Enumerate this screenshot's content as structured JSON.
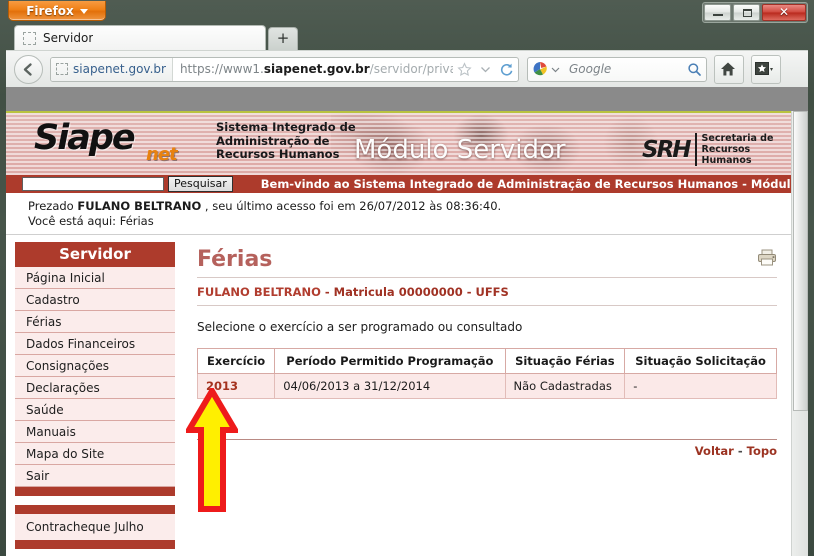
{
  "browser": {
    "app_button": "Firefox",
    "window_controls": {
      "minimize": "minimize-icon",
      "maximize": "maximize-icon",
      "close": "✕"
    },
    "tab": {
      "title": "Servidor",
      "favicon": "page-icon"
    },
    "new_tab_label": "+",
    "back_label": "back-arrow-icon",
    "url": {
      "site_chip": "siapenet.gov.br",
      "scheme": "https://www1.",
      "domain": "siapenet.gov.br",
      "path": "/servidor/private/pages/inform"
    },
    "star_icon": "star-icon",
    "dropdown_icon": "chevron-down-icon",
    "reload_icon": "reload-icon",
    "search": {
      "engine": "Google",
      "placeholder": "Google"
    },
    "home_icon": "home-icon",
    "bookmarks_icon": "bookmarks-icon"
  },
  "banner": {
    "logo_main": "Siape",
    "logo_suffix": "net",
    "tagline_line1": "Sistema Integrado de",
    "tagline_line2": "Administração de",
    "tagline_line3": "Recursos Humanos",
    "module": "Módulo Servidor",
    "srh_mark": "SRH",
    "srh_line1": "Secretaria de",
    "srh_line2": "Recursos Humanos"
  },
  "search_row": {
    "input_value": "",
    "button_label": "Pesquisar",
    "welcome": "Bem-vindo ao Sistema Integrado de Administração de Recursos Humanos - Módulo"
  },
  "greeting": {
    "prefix": "Prezado",
    "user": "FULANO BELTRANO",
    "suffix": ", seu último acesso foi em 26/07/2012 às 08:36:40.",
    "breadcrumb": "Você está aqui: Férias"
  },
  "sidebar": {
    "title": "Servidor",
    "items": [
      {
        "label": "Página Inicial"
      },
      {
        "label": "Cadastro"
      },
      {
        "label": "Férias"
      },
      {
        "label": "Dados Financeiros"
      },
      {
        "label": "Consignações"
      },
      {
        "label": "Declarações"
      },
      {
        "label": "Saúde"
      },
      {
        "label": "Manuais"
      },
      {
        "label": "Mapa do Site"
      },
      {
        "label": "Sair"
      }
    ],
    "promo_label": "Contracheque Julho"
  },
  "main": {
    "print_icon": "printer-icon",
    "title": "Férias",
    "user_name": "FULANO BELTRANO",
    "user_meta": "- Matricula 00000000 - UFFS",
    "instruction": "Selecione o exercício a ser programado ou consultado",
    "table": {
      "headers": [
        "Exercício",
        "Período Permitido Programação",
        "Situação Férias",
        "Situação Solicitação"
      ],
      "rows": [
        {
          "exercicio": "2013",
          "periodo": "04/06/2013 a 31/12/2014",
          "situacao_ferias": "Não Cadastradas",
          "situacao_solicitacao": "-"
        }
      ]
    },
    "footer": {
      "back_label": "Voltar",
      "separator": "-",
      "top_label": "Topo"
    }
  },
  "annotation": {
    "arrow": "up-arrow-annotation",
    "fill_color": "#ffef00",
    "stroke_color": "#ee1b1b"
  }
}
